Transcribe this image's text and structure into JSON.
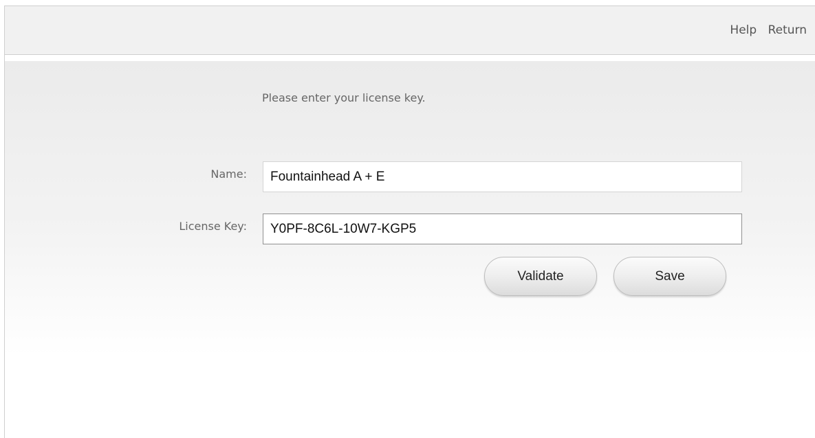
{
  "header": {
    "help_label": "Help",
    "return_label": "Return"
  },
  "form": {
    "prompt": "Please enter your license key.",
    "name_label": "Name:",
    "name_value": "Fountainhead A + E",
    "license_label": "License Key:",
    "license_value": "Y0PF-8C6L-10W7-KGP5",
    "validate_label": "Validate",
    "save_label": "Save"
  }
}
